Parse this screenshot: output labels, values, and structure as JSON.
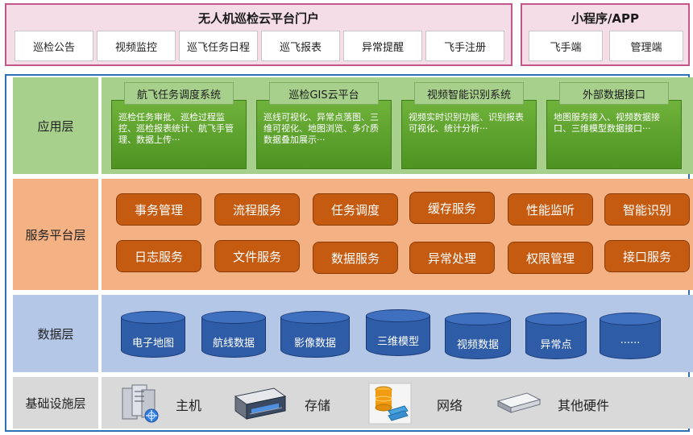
{
  "portal": {
    "title": "无人机巡检云平台门户",
    "items": [
      "巡检公告",
      "视频监控",
      "巡飞任务日程",
      "巡飞报表",
      "异常提醒",
      "飞手注册"
    ]
  },
  "mini_app": {
    "title": "小程序/APP",
    "items": [
      "飞手端",
      "管理端"
    ]
  },
  "layers": {
    "app": "应用层",
    "service": "服务平台层",
    "data": "数据层",
    "infra": "基础设施层"
  },
  "app_modules": [
    {
      "title": "航飞任务调度系统",
      "desc": "巡检任务审批、巡检过程监控、巡检报表统计、航飞手管理、数据上传···"
    },
    {
      "title": "巡检GIS云平台",
      "desc": "巡线可视化、异常点落图、三维可视化、地图浏览、多介质数据叠加展示···"
    },
    {
      "title": "视频智能识别系统",
      "desc": "视频实时识别功能、识别报表可视化、统计分析···"
    },
    {
      "title": "外部数据接口",
      "desc": "地图服务接入、视频数据接口、三维模型数据接口···"
    }
  ],
  "services": {
    "row1": [
      "事务管理",
      "流程服务",
      "任务调度",
      "缓存服务",
      "性能监听",
      "智能识别"
    ],
    "row2": [
      "日志服务",
      "文件服务",
      "数据服务",
      "异常处理",
      "权限管理",
      "接口服务"
    ]
  },
  "data_stores": [
    "电子地图",
    "航线数据",
    "影像数据",
    "三维模型",
    "视频数据",
    "异常点",
    "······"
  ],
  "infra": [
    {
      "label": "主机",
      "icon": "server-host-icon"
    },
    {
      "label": "存储",
      "icon": "storage-icon"
    },
    {
      "label": "网络",
      "icon": "network-icon"
    },
    {
      "label": "其他硬件",
      "icon": "hardware-icon"
    }
  ],
  "colors": {
    "portal_bg": "#f4dde6",
    "portal_border": "#c2588a",
    "frame_border": "#2f6fb6",
    "app_bg": "#a8d08d",
    "app_module": "#5aa02c",
    "service_bg": "#f4b183",
    "service_item": "#c55a11",
    "data_bg": "#b4c7e7",
    "data_item": "#2f5ca6",
    "infra_bg": "#d9d9d9"
  }
}
